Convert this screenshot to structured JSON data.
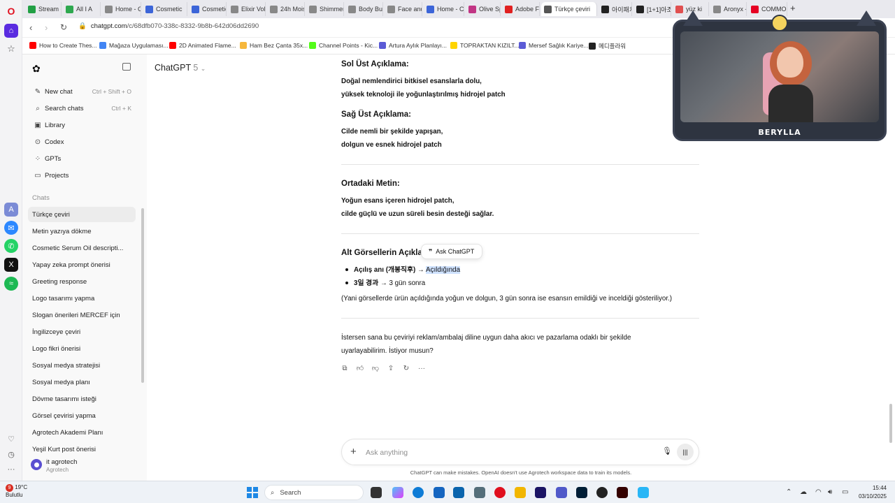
{
  "browser": {
    "tabs": [
      {
        "label": "Stream -",
        "color": "#22a045"
      },
      {
        "label": "All I A",
        "color": "#2ea84f"
      },
      {
        "label": "Home - C",
        "color": "#888888"
      },
      {
        "label": "Cosmetic",
        "color": "#3c65d8"
      },
      {
        "label": "Cosmetic",
        "color": "#3c65d8"
      },
      {
        "label": "Elixir Volc",
        "color": "#888888"
      },
      {
        "label": "24h Moist",
        "color": "#888888"
      },
      {
        "label": "Shimmer",
        "color": "#888888"
      },
      {
        "label": "Body Butt",
        "color": "#888888"
      },
      {
        "label": "Face and",
        "color": "#888888"
      },
      {
        "label": "Home - C",
        "color": "#3c65d8"
      },
      {
        "label": "Olive Spa",
        "color": "#c13584"
      },
      {
        "label": "Adobe Fi",
        "color": "#e02020"
      },
      {
        "label": "Türkçe çeviri",
        "color": "#555555",
        "active": true
      },
      {
        "label": "아이패치",
        "color": "#222222"
      },
      {
        "label": "[1+1]아조",
        "color": "#222222"
      },
      {
        "label": "yüz ki",
        "color": "#e05050"
      },
      {
        "label": "Aronyx -",
        "color": "#888888"
      },
      {
        "label": "COMMO",
        "color": "#e60023"
      }
    ],
    "url_host": "chatgpt.com",
    "url_path": "/c/68dfb070-338c-8332-9b8b-642d06dd2690",
    "bookmarks": [
      {
        "label": "How to Create Thes...",
        "color": "#ff0000"
      },
      {
        "label": "Mağaza Uygulaması...",
        "color": "#4285f4"
      },
      {
        "label": "2D Animated Flame...",
        "color": "#ff0000"
      },
      {
        "label": "Ham Bez Çanta 35x...",
        "color": "#f6b73c"
      },
      {
        "label": "Channel Points - Kic...",
        "color": "#53fc18"
      },
      {
        "label": "Artura Aylık Planlayı...",
        "color": "#5b5bd6"
      },
      {
        "label": "TOPRAKTAN KIZILT...",
        "color": "#ffd400"
      },
      {
        "label": "Mersef Sağlık Kariye...",
        "color": "#5b5bd6"
      },
      {
        "label": "메디플라워",
        "color": "#222222"
      }
    ]
  },
  "sidebar": {
    "new_chat": "New chat",
    "new_chat_shortcut": "Ctrl + Shift + O",
    "search_chats": "Search chats",
    "search_shortcut": "Ctrl + K",
    "library": "Library",
    "codex": "Codex",
    "gpts": "GPTs",
    "projects": "Projects",
    "chats_heading": "Chats",
    "chats": [
      "Türkçe çeviri",
      "Metin yazıya dökme",
      "Cosmetic Serum Oil descripti...",
      "Yapay zeka prompt önerisi",
      "Greeting response",
      "Logo tasarımı yapma",
      "Slogan önerileri MERCEF için",
      "İngilizceye çeviri",
      "Logo fikri önerisi",
      "Sosyal medya stratejisi",
      "Sosyal medya planı",
      "Dövme tasarımı isteği",
      "Görsel çevirisi yapma",
      "Agrotech Akademi Planı",
      "Yeşil Kurt post önerisi"
    ],
    "user_name": "it agrotech",
    "user_org": "Agrotech"
  },
  "main": {
    "model_name": "ChatGPT",
    "model_version": "5",
    "sections": {
      "sol_ust_title": "Sol Üst Açıklama:",
      "sol_ust_line1": "Doğal nemlendirici bitkisel esanslarla dolu,",
      "sol_ust_line2": "yüksek teknoloji ile yoğunlaştırılmış hidrojel patch",
      "sag_ust_title": "Sağ Üst Açıklama:",
      "sag_ust_line1": "Cilde nemli bir şekilde yapışan,",
      "sag_ust_line2": "dolgun ve esnek hidrojel patch",
      "orta_title": "Ortadaki Metin:",
      "orta_line1": "Yoğun esans içeren hidrojel patch,",
      "orta_line2": "cilde güçlü ve uzun süreli besin desteği sağlar.",
      "alt_title": "Alt Görsellerin Açıkla",
      "bullet1_bold": "Açılış anı (개봉직후) →",
      "bullet1_highlight": "Açıldığında",
      "bullet2_bold": "3일 경과",
      "bullet2_rest": "→ 3 gün sonra",
      "explanation": "(Yani görsellerde ürün açıldığında yoğun ve dolgun, 3 gün sonra ise esansın emildiği ve inceldiği gösteriliyor.)",
      "offer_line1": "İstersen sana bu çeviriyi reklam/ambalaj diline uygun daha akıcı ve pazarlama odaklı bir şekilde",
      "offer_line2": "uyarlayabilirim. İstiyor musun?"
    },
    "ask_popup": "Ask ChatGPT",
    "composer_placeholder": "Ask anything",
    "disclaimer": "ChatGPT can make mistakes. OpenAI doesn't use Agrotech workspace data to train its models."
  },
  "webcam": {
    "name": "BERYLLA"
  },
  "taskbar": {
    "notification_count": "9",
    "temperature": "19°C",
    "weather": "Bulutlu",
    "search_label": "Search",
    "time": "15:44",
    "date": "03/10/2025"
  },
  "colors": {
    "accent": "#5a4fd1",
    "highlight": "#cfe2ff",
    "opera_red": "#e0101f"
  }
}
